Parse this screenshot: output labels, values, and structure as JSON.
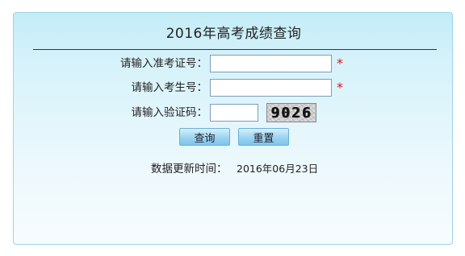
{
  "panel": {
    "title": "2016年高考成绩查询"
  },
  "form": {
    "exam_number": {
      "label": "请输入准考证号：",
      "value": "",
      "required_mark": "*"
    },
    "student_number": {
      "label": "请输入考生号：",
      "value": "",
      "required_mark": "*"
    },
    "captcha": {
      "label": "请输入验证码：",
      "value": "",
      "image_text": "9026"
    },
    "query_button": "查询",
    "reset_button": "重置"
  },
  "update": {
    "label": "数据更新时间：",
    "value": "2016年06月23日"
  },
  "colors": {
    "panel_border": "#9fd3e8",
    "panel_top": "#c3ecf7",
    "required_star": "#e01010",
    "button": "#9fd6f1"
  }
}
